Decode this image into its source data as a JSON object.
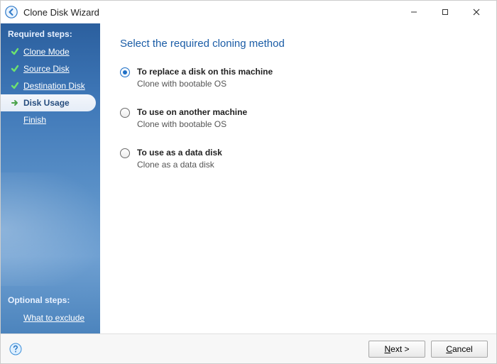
{
  "titlebar": {
    "title": "Clone Disk Wizard"
  },
  "sidebar": {
    "required_header": "Required steps:",
    "optional_header": "Optional steps:",
    "steps": [
      {
        "label": "Clone Mode",
        "state": "done"
      },
      {
        "label": "Source Disk",
        "state": "done"
      },
      {
        "label": "Destination Disk",
        "state": "done"
      },
      {
        "label": "Disk Usage",
        "state": "active"
      },
      {
        "label": "Finish",
        "state": "pending"
      }
    ],
    "optional_steps": [
      {
        "label": "What to exclude"
      }
    ]
  },
  "main": {
    "heading": "Select the required cloning method",
    "options": [
      {
        "title": "To replace a disk on this machine",
        "desc": "Clone with bootable OS",
        "selected": true
      },
      {
        "title": "To use on another machine",
        "desc": "Clone with bootable OS",
        "selected": false
      },
      {
        "title": "To use as a data disk",
        "desc": "Clone as a data disk",
        "selected": false
      }
    ]
  },
  "footer": {
    "next_label": "Next >",
    "cancel_label": "Cancel"
  }
}
